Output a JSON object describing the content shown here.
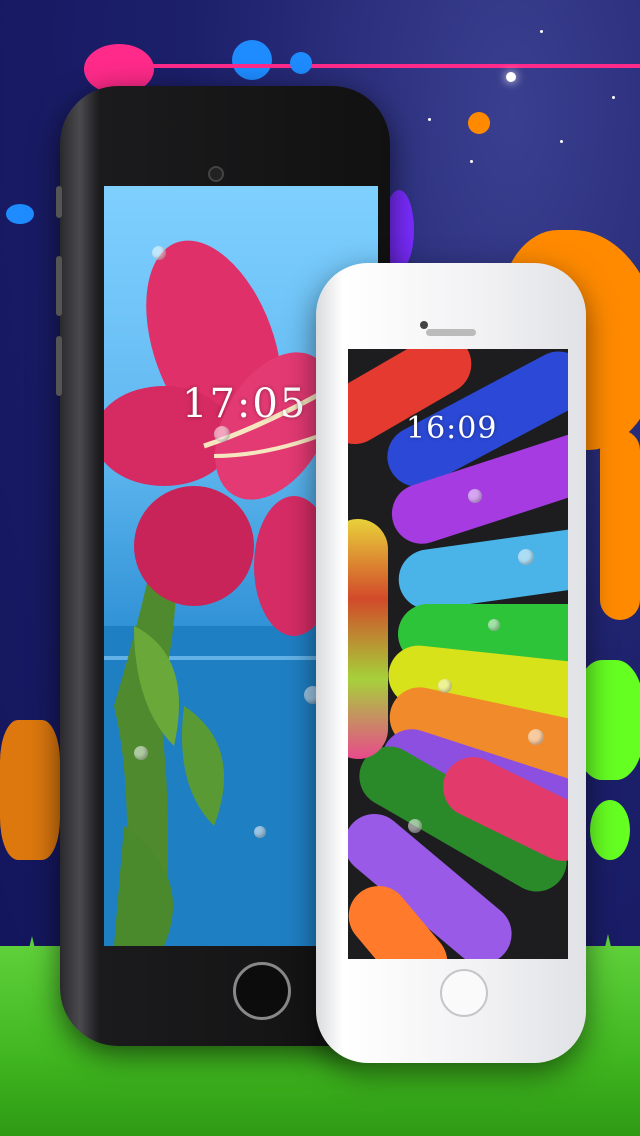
{
  "phones": {
    "black": {
      "lock_time": "17:05"
    },
    "white": {
      "lock_time": "16:09"
    }
  },
  "colors": {
    "background": "#1c1f6a",
    "grass": "#3fb51f",
    "splash_orange": "#ff8a00",
    "splash_pink": "#ff2a8a",
    "splash_blue": "#1e8cff",
    "splash_green": "#66ff22"
  },
  "icons": [
    "home-button-icon",
    "camera-icon",
    "speaker-icon"
  ]
}
